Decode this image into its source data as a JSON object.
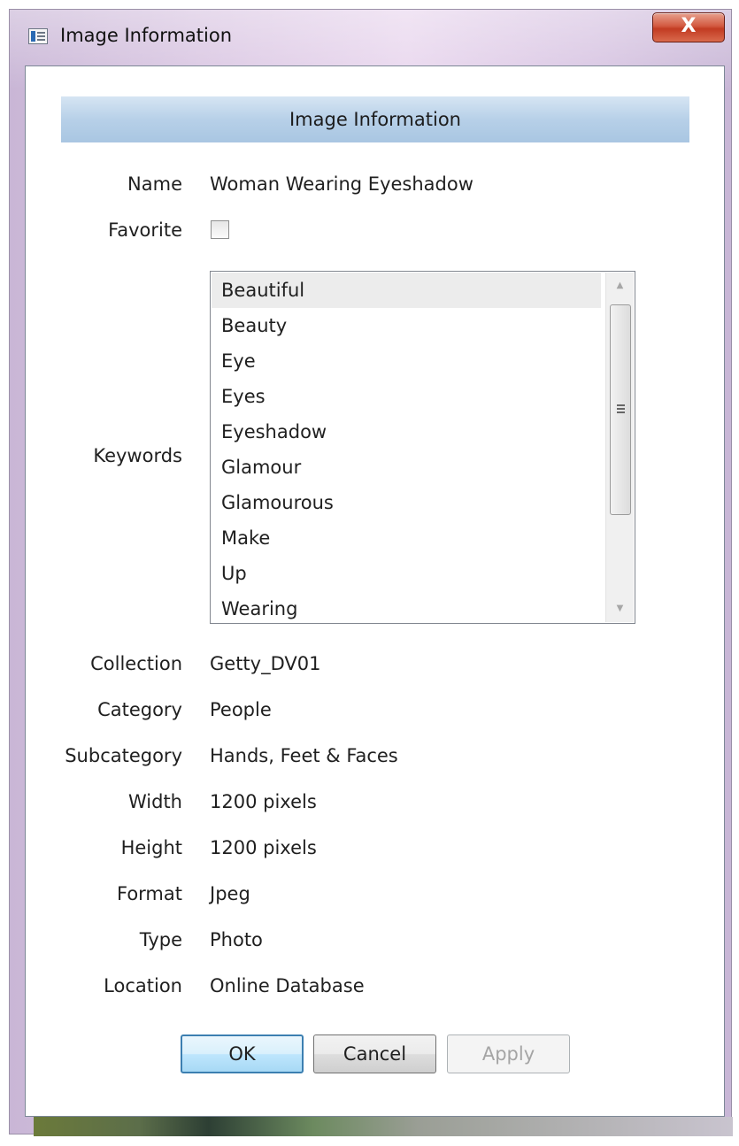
{
  "window": {
    "title": "Image Information",
    "close_label": "X"
  },
  "header": {
    "title": "Image Information"
  },
  "fields": {
    "name_label": "Name",
    "name_value": "Woman Wearing Eyeshadow",
    "favorite_label": "Favorite",
    "favorite_checked": false,
    "keywords_label": "Keywords",
    "collection_label": "Collection",
    "collection_value": "Getty_DV01",
    "category_label": "Category",
    "category_value": "People",
    "subcategory_label": "Subcategory",
    "subcategory_value": "Hands, Feet & Faces",
    "width_label": "Width",
    "width_value": "1200 pixels",
    "height_label": "Height",
    "height_value": "1200 pixels",
    "format_label": "Format",
    "format_value": "Jpeg",
    "type_label": "Type",
    "type_value": "Photo",
    "location_label": "Location",
    "location_value": "Online Database"
  },
  "keywords": [
    "Beautiful",
    "Beauty",
    "Eye",
    "Eyes",
    "Eyeshadow",
    "Glamour",
    "Glamourous",
    "Make",
    "Up",
    "Wearing"
  ],
  "keywords_selected_index": 0,
  "buttons": {
    "ok": "OK",
    "cancel": "Cancel",
    "apply": "Apply",
    "apply_enabled": false
  },
  "colors": {
    "header_bar": "#b7d0e8",
    "close_button": "#c23b22",
    "ok_border": "#3c7fb1"
  }
}
